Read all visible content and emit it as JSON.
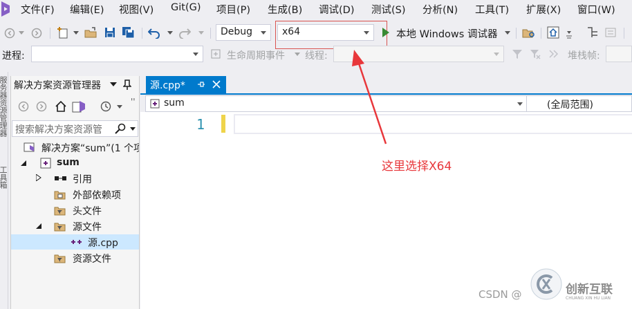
{
  "menu": [
    "文件(F)",
    "编辑(E)",
    "视图(V)",
    "Git(G)",
    "项目(P)",
    "生成(B)",
    "调试(D)",
    "测试(S)",
    "分析(N)",
    "工具(T)",
    "扩展(X)",
    "窗口(W)"
  ],
  "toolbar": {
    "config": "Debug",
    "platform": "x64",
    "run_label": "本地 Windows 调试器"
  },
  "debug_bar": {
    "process_label": "进程:",
    "lifecycle_label": "生命周期事件",
    "thread_label": "线程:",
    "stack_label": "堆栈帧:"
  },
  "left_strip": {
    "top": "服务器资源管理器",
    "bottom": "工具箱"
  },
  "solution_explorer": {
    "title": "解决方案资源管理器",
    "search_placeholder": "搜索解决方案资源管",
    "tree": [
      {
        "label": "解决方案“sum”(1 个项",
        "icon": "solution-icon",
        "level": 0
      },
      {
        "label": "sum",
        "icon": "project-icon",
        "level": 1,
        "bold": true
      },
      {
        "label": "引用",
        "icon": "references-icon",
        "level": 2
      },
      {
        "label": "外部依赖项",
        "icon": "external-dependencies-icon",
        "level": 2
      },
      {
        "label": "头文件",
        "icon": "filter-folder-icon",
        "level": 2
      },
      {
        "label": "源文件",
        "icon": "filter-folder-icon",
        "level": 2
      },
      {
        "label": "源.cpp",
        "icon": "cpp-file-icon",
        "level": 3,
        "selected": true
      },
      {
        "label": "资源文件",
        "icon": "filter-folder-icon",
        "level": 2
      }
    ]
  },
  "editor": {
    "tab_label": "源.cpp*",
    "nav_project": "sum",
    "nav_scope": "(全局范围)",
    "line_number": "1"
  },
  "annotation": "这里选择X64",
  "watermark": {
    "csdn": "CSDN @",
    "brand": "创新互联",
    "brand_pinyin": "CHUANG XIN HU LIAN"
  },
  "colors": {
    "accent": "#007acc",
    "annotation": "#e8373b",
    "selection": "#cce8ff",
    "vs_purple": "#68217a"
  }
}
